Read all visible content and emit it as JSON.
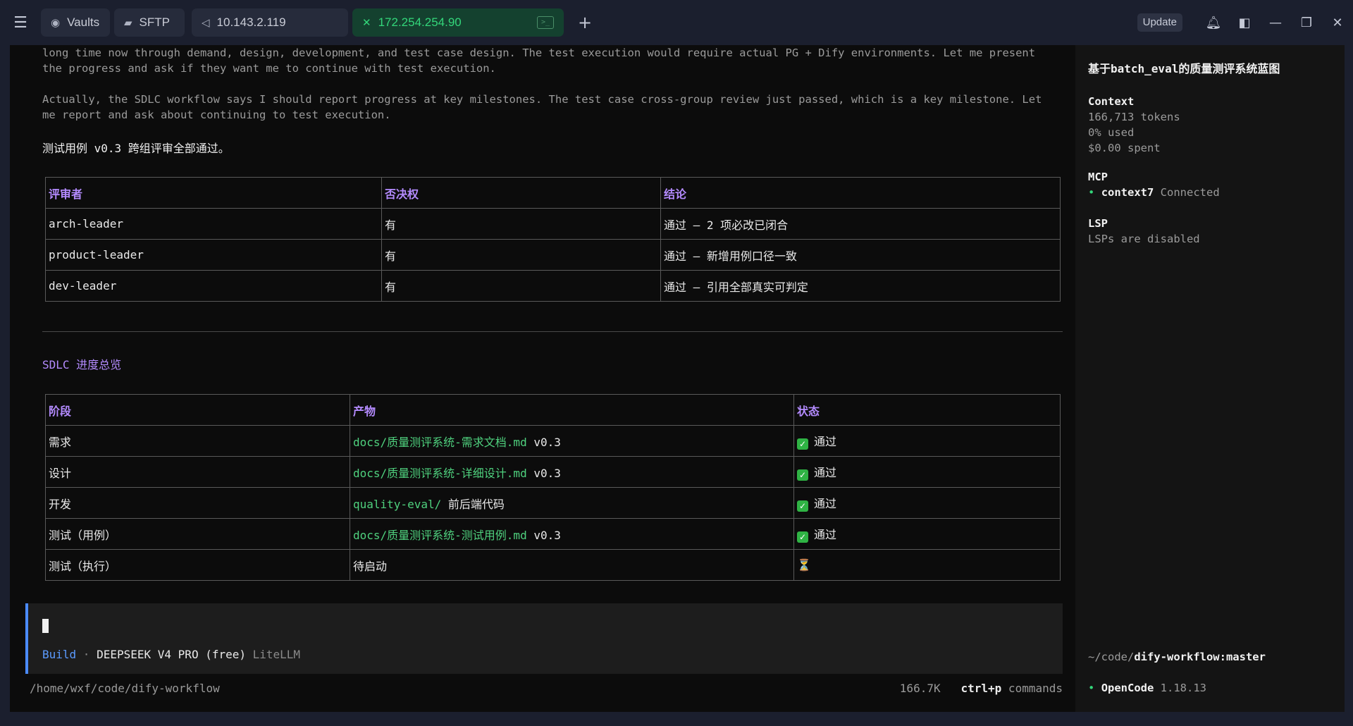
{
  "tabs": {
    "vaults": "Vaults",
    "sftp": "SFTP",
    "host1": "10.143.2.119",
    "host2": "172.254.254.90"
  },
  "topbar": {
    "update": "Update"
  },
  "conversation": {
    "para1": "long time now through demand, design, development, and test case design. The test execution would require actual PG + Dify environments. Let me present the progress and ask if they want me to continue with test execution.",
    "para2": "Actually, the SDLC workflow says I should report progress at key milestones. The test case cross-group review just passed, which is a key milestone. Let me report and ask about continuing to test execution.",
    "summary": "测试用例 v0.3 跨组评审全部通过。",
    "review_table": {
      "headers": [
        "评审者",
        "否决权",
        "结论"
      ],
      "rows": [
        [
          "arch-leader",
          "有",
          "通过 — 2 项必改已闭合"
        ],
        [
          "product-leader",
          "有",
          "通过 — 新增用例口径一致"
        ],
        [
          "dev-leader",
          "有",
          "通过 — 引用全部真实可判定"
        ]
      ]
    },
    "section_title": "SDLC 进度总览",
    "progress_table": {
      "headers": [
        "阶段",
        "产物",
        "状态"
      ],
      "rows": [
        {
          "stage": "需求",
          "artifact_path": "docs/质量测评系统-需求文档.md",
          "artifact_suffix": " v0.3",
          "status_icon": "✓",
          "status": "通过"
        },
        {
          "stage": "设计",
          "artifact_path": "docs/质量测评系统-详细设计.md",
          "artifact_suffix": " v0.3",
          "status_icon": "✓",
          "status": "通过"
        },
        {
          "stage": "开发",
          "artifact_path": "quality-eval/",
          "artifact_suffix": " 前后端代码",
          "status_icon": "✓",
          "status": "通过"
        },
        {
          "stage": "测试（用例）",
          "artifact_path": "docs/质量测评系统-测试用例.md",
          "artifact_suffix": " v0.3",
          "status_icon": "✓",
          "status": "通过"
        },
        {
          "stage": "测试（执行）",
          "artifact_path": "",
          "artifact_suffix": "待启动",
          "status_icon": "⏳",
          "status": ""
        }
      ]
    }
  },
  "input": {
    "mode": "Build",
    "sep": " · ",
    "model": "DEEPSEEK V4 PRO (free)",
    "provider": " LiteLLM"
  },
  "status": {
    "cwd": "/home/wxf/code/dify-workflow",
    "tokens": "166.7K",
    "shortcut": "ctrl+p",
    "shortcut_label": " commands"
  },
  "sidebar": {
    "title": "基于batch_eval的质量测评系统蓝图",
    "context_label": "Context",
    "context_tokens": "166,713 tokens",
    "context_used": "0% used",
    "context_spent": "$0.00 spent",
    "mcp_label": "MCP",
    "mcp_name": "context7",
    "mcp_status": " Connected",
    "lsp_label": "LSP",
    "lsp_status": "LSPs are disabled",
    "repo_prefix": "~/code/",
    "repo_name": "dify-workflow:master",
    "app_name": "OpenCode",
    "app_version": " 1.18.13"
  },
  "colors": {
    "accent": "#b48bff",
    "green": "#4fd17e",
    "active_tab": "#14412f",
    "link_blue": "#5b9bff"
  }
}
